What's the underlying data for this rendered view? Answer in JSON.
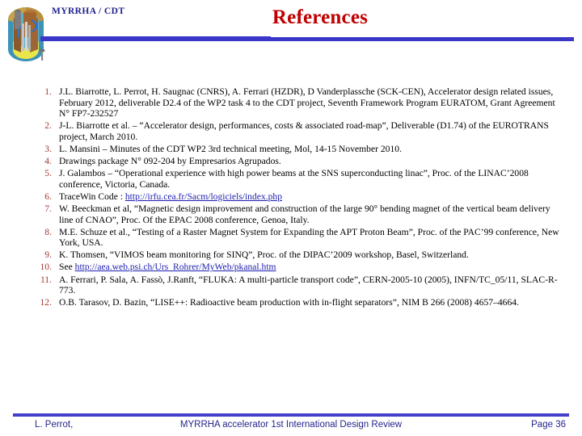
{
  "header": {
    "project_label": "MYRRHA / CDT",
    "title": "References",
    "logo_name": "myrrha-reactor-vessel-logo",
    "accent_color": "#3a36c8",
    "title_color": "#c00000",
    "label_color": "#1f1f8f"
  },
  "references": {
    "number_color": "#a33a33",
    "link_color": "#2020b0",
    "items": [
      {
        "number": "1.",
        "text": "J.L. Biarrotte, L. Perrot, H. Saugnac (CNRS), A. Ferrari (HZDR), D Vanderplassche (SCK-CEN), Accelerator design related issues, February 2012, deliverable D2.4 of the WP2 task 4 to the CDT project, Seventh Framework Program EURATOM, Grant Agreement N° FP7-232527"
      },
      {
        "number": "2.",
        "text": "J-L. Biarrotte et al. – “Accelerator design, performances, costs & associated road-map”, Deliverable (D1.74) of the EUROTRANS project, March 2010."
      },
      {
        "number": "3.",
        "text": "L. Mansini – Minutes of the CDT WP2 3rd technical meeting, Mol, 14-15 November 2010."
      },
      {
        "number": "4.",
        "text": "Drawings package N° 092-204 by Empresarios Agrupados."
      },
      {
        "number": "5.",
        "text": "J. Galambos – “Operational experience with high power beams at the SNS superconducting linac”, Proc. of the LINAC’2008 conference, Victoria, Canada."
      },
      {
        "number": "6.",
        "prefix": "TraceWin Code : ",
        "link": "http://irfu.cea.fr/Sacm/logiciels/index.php",
        "suffix": ""
      },
      {
        "number": "7.",
        "text": "W. Beeckman et al, “Magnetic design improvement and construction of the large 90° bending magnet of the vertical beam delivery line of CNAO”, Proc. Of the EPAC 2008 conference, Genoa, Italy."
      },
      {
        "number": "8.",
        "text": "M.E. Schuze et al., “Testing of a Raster Magnet System for Expanding the APT Proton Beam”, Proc. of the PAC’99 conference, New York, USA."
      },
      {
        "number": "9.",
        "text": "K. Thomsen, “VIMOS beam monitoring for SINQ”, Proc. of the DIPAC’2009 workshop, Basel, Switzerland."
      },
      {
        "number": "10.",
        "prefix": "See ",
        "link": "http://aea.web.psi.ch/Urs_Rohrer/MyWeb/pkanal.htm",
        "suffix": ""
      },
      {
        "number": "11.",
        "text": "A. Ferrari, P. Sala, A. Fassò, J.Ranft, “FLUKA: A multi-particle transport code”, CERN-2005-10 (2005), INFN/TC_05/11, SLAC-R-773."
      },
      {
        "number": "12.",
        "text": "O.B. Tarasov, D. Bazin, “LISE++: Radioactive beam production with in-flight separators”, NIM B 266 (2008) 4657–4664."
      }
    ]
  },
  "footer": {
    "left": "L. Perrot,",
    "center": "MYRRHA accelerator 1st International Design Review",
    "page": "Page 36",
    "rule_color": "#4440cc",
    "text_color": "#26268c"
  }
}
